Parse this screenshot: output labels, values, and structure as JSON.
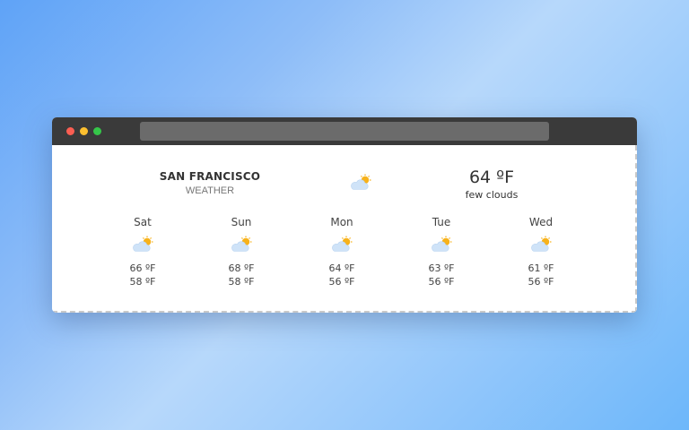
{
  "window": {
    "address_bar_value": ""
  },
  "location": {
    "city": "SAN FRANCISCO",
    "label": "WEATHER"
  },
  "current": {
    "temperature": "64 ºF",
    "description": "few clouds",
    "icon": "partly-cloudy-icon"
  },
  "forecast": [
    {
      "day": "Sat",
      "high": "66 ºF",
      "low": "58 ºF",
      "icon": "partly-cloudy-icon"
    },
    {
      "day": "Sun",
      "high": "68 ºF",
      "low": "58 ºF",
      "icon": "partly-cloudy-icon"
    },
    {
      "day": "Mon",
      "high": "64 ºF",
      "low": "56 ºF",
      "icon": "partly-cloudy-icon"
    },
    {
      "day": "Tue",
      "high": "63 ºF",
      "low": "56 ºF",
      "icon": "partly-cloudy-icon"
    },
    {
      "day": "Wed",
      "high": "61 ºF",
      "low": "56 ºF",
      "icon": "partly-cloudy-icon"
    }
  ],
  "colors": {
    "close": "#fb5e52",
    "minimize": "#fcbf2f",
    "maximize": "#35c649",
    "cloud": "#cfe3f8",
    "sun": "#f7b21b"
  }
}
